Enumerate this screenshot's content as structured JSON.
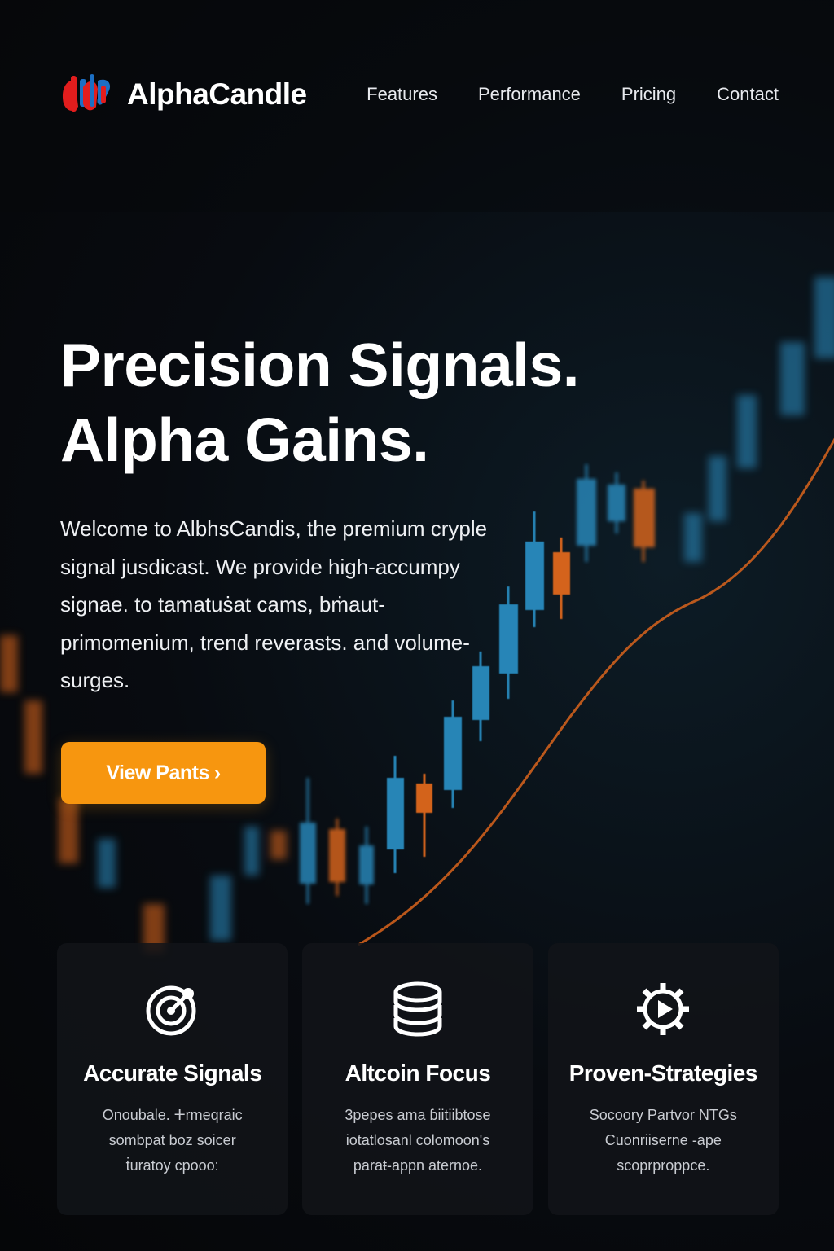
{
  "brand": {
    "name": "AlphaCandle",
    "logo_icon": "candlestick-logo-icon"
  },
  "nav": {
    "items": [
      "Features",
      "Performance",
      "Pricing",
      "Contact"
    ]
  },
  "hero": {
    "title_line1": "Precision Signals.",
    "title_line2": "Alpha Gains.",
    "description": "Welcome to AlbhsCandis, the premium cryple signal jusdicast. We provide high-accumpy signae. to tamatuṡat cams, bṁaut-primomenium, trend reverasts. and volume-surges.",
    "cta_label": "View Pants",
    "cta_arrow": "›"
  },
  "features": [
    {
      "icon": "target-icon",
      "title": "Accurate Signals",
      "lines": [
        "Onoubale. ⵜrmeqraic",
        "sombpat boz soicer",
        "ṫuratoy cpooo:"
      ]
    },
    {
      "icon": "coin-stack-icon",
      "title": "Altcoin Focus",
      "lines": [
        "3pepes ama ɓiitiibtose",
        "iotatlosanl colomoon's",
        "paraŧ-appn aternoe."
      ]
    },
    {
      "icon": "gear-play-icon",
      "title": "Proven-Strategies",
      "lines": [
        "Socoory Partvor NTGs",
        "Cuonriiserne -ape",
        "scoprproppce."
      ]
    }
  ],
  "colors": {
    "accent": "#f7960f",
    "candle_blue": "#2a8fc4",
    "candle_orange": "#e56a1e",
    "background": "#07090c",
    "card_bg": "#121418"
  }
}
